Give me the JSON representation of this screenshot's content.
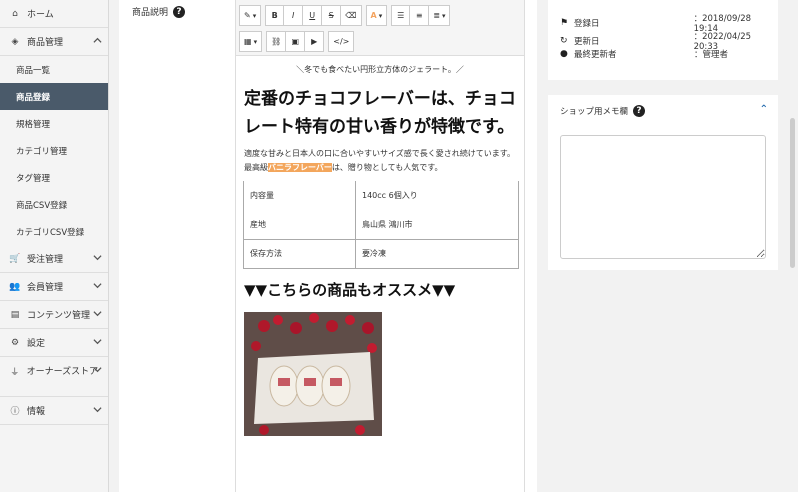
{
  "sidebar": {
    "home": "ホーム",
    "product_mgmt": "商品管理",
    "sub_items": [
      "商品一覧",
      "商品登録",
      "規格管理",
      "カテゴリ管理",
      "タグ管理",
      "商品CSV登録",
      "カテゴリCSV登録"
    ],
    "active_sub": "商品登録",
    "order_mgmt": "受注管理",
    "member_mgmt": "会員管理",
    "content_mgmt": "コンテンツ管理",
    "settings": "設定",
    "owners_store": "オーナーズストア",
    "info": "情報"
  },
  "main": {
    "desc_label": "商品説明",
    "help_icon": "?"
  },
  "toolbar": {
    "bold": "B",
    "italic": "I",
    "underline": "U",
    "strike": "S",
    "font_color": "A",
    "code": "</>"
  },
  "editor_content": {
    "catch_copy": "＼冬でも食べたい円形立方体のジェラート。／",
    "heading": "定番のチョコフレーバーは、チョコレート特有の甘い香りが特徴です。",
    "para_before": "適度な甘みと日本人の口に合いやすいサイズ感で長く愛され続けています。最高級",
    "para_highlight": "バニラフレーバー",
    "para_after": "は、贈り物としても人気です。",
    "spec_rows": [
      {
        "label": "内容量",
        "value": "140cc 6個入り"
      },
      {
        "label": "産地",
        "value": "鳥山県 鴻川市"
      },
      {
        "label": "保存方法",
        "value": "要冷凍"
      }
    ],
    "recommend": "▼▼こちらの商品もオススメ▼▼"
  },
  "info_card": {
    "registered_label": "登録日",
    "registered_value": "：2018/09/28 19:14",
    "updated_label": "更新日",
    "updated_value": "：2022/04/25 20:33",
    "updater_label": "最終更新者",
    "updater_value": "：管理者"
  },
  "memo_card": {
    "title": "ショップ用メモ欄",
    "help_icon": "?"
  },
  "colors": {
    "active_sidebar": "#4a5a6a",
    "highlight": "#f3a65c",
    "accent": "#2a6fb0"
  }
}
